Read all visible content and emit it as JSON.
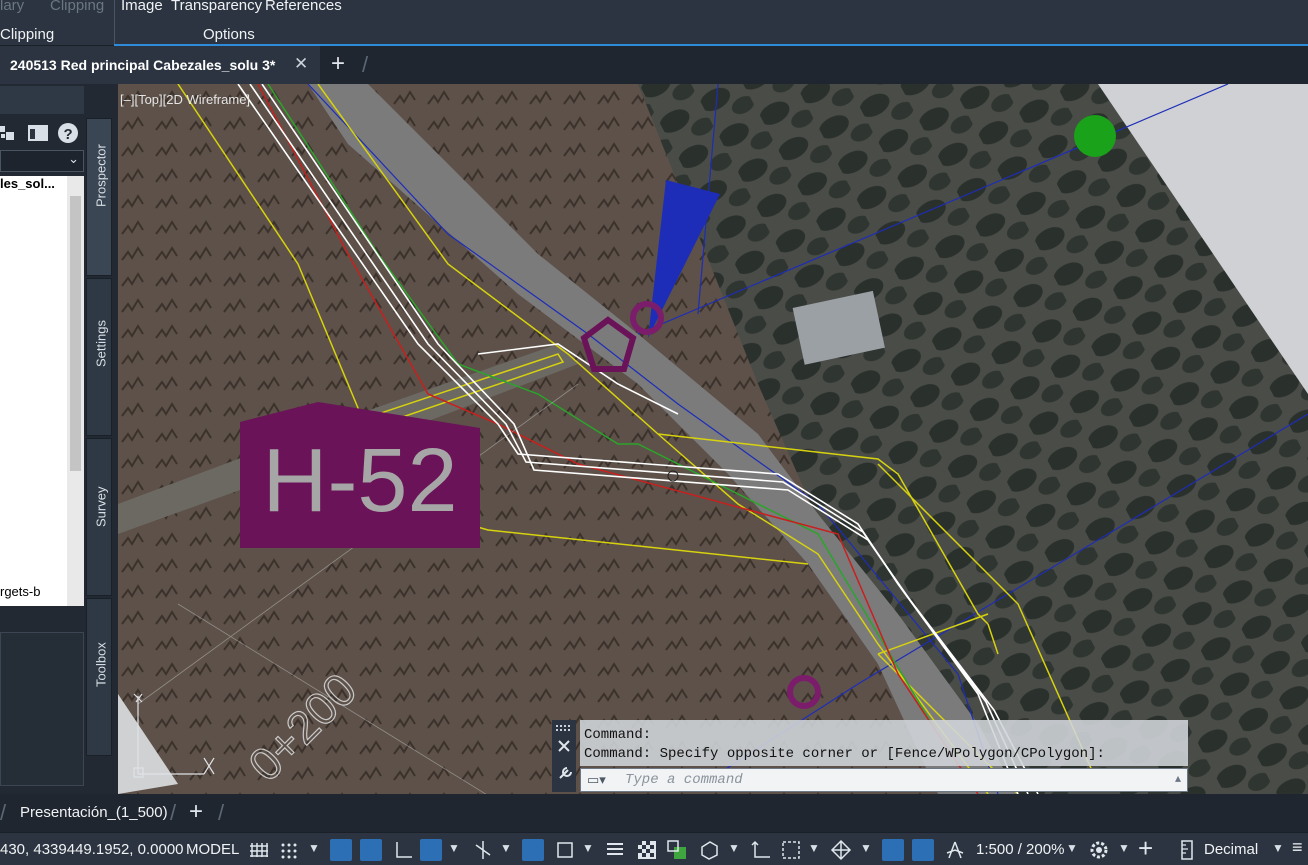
{
  "ribbon": {
    "row1": {
      "left_dim": "lary",
      "clipping_dim": "Clipping",
      "image": "Image",
      "transparency": "Transparency",
      "references": "References"
    },
    "row2": {
      "clipping": "Clipping",
      "options": "Options"
    }
  },
  "tabs": {
    "document": "240513 Red principal Cabezales_solu 3*",
    "close": "✕",
    "new": "+"
  },
  "left_panel": {
    "tree_item": "les_sol...",
    "tree_item_bottom": "rgets-b",
    "vertical_tabs": [
      "Prospector",
      "Settings",
      "Survey",
      "Toolbox"
    ]
  },
  "viewport": {
    "label": "[–][Top][2D Wireframe]",
    "station_label": "0+200",
    "block_label": "H-52",
    "colors": {
      "magenta": "#6b1358",
      "yellow": "#d7d20e",
      "blue": "#1d2db8",
      "green": "#2ba42b",
      "red": "#c8201e"
    }
  },
  "command": {
    "history": [
      "Command:",
      "Command: Specify opposite corner or [Fence/WPolygon/CPolygon]:"
    ],
    "placeholder": "Type a command"
  },
  "layout_tabs": {
    "current": "Presentación_(1_500)",
    "add": "+"
  },
  "status": {
    "coords": "430, 4339449.1952, 0.0000",
    "model": "MODEL",
    "scale": "1:500 / 200%",
    "units": "Decimal"
  }
}
